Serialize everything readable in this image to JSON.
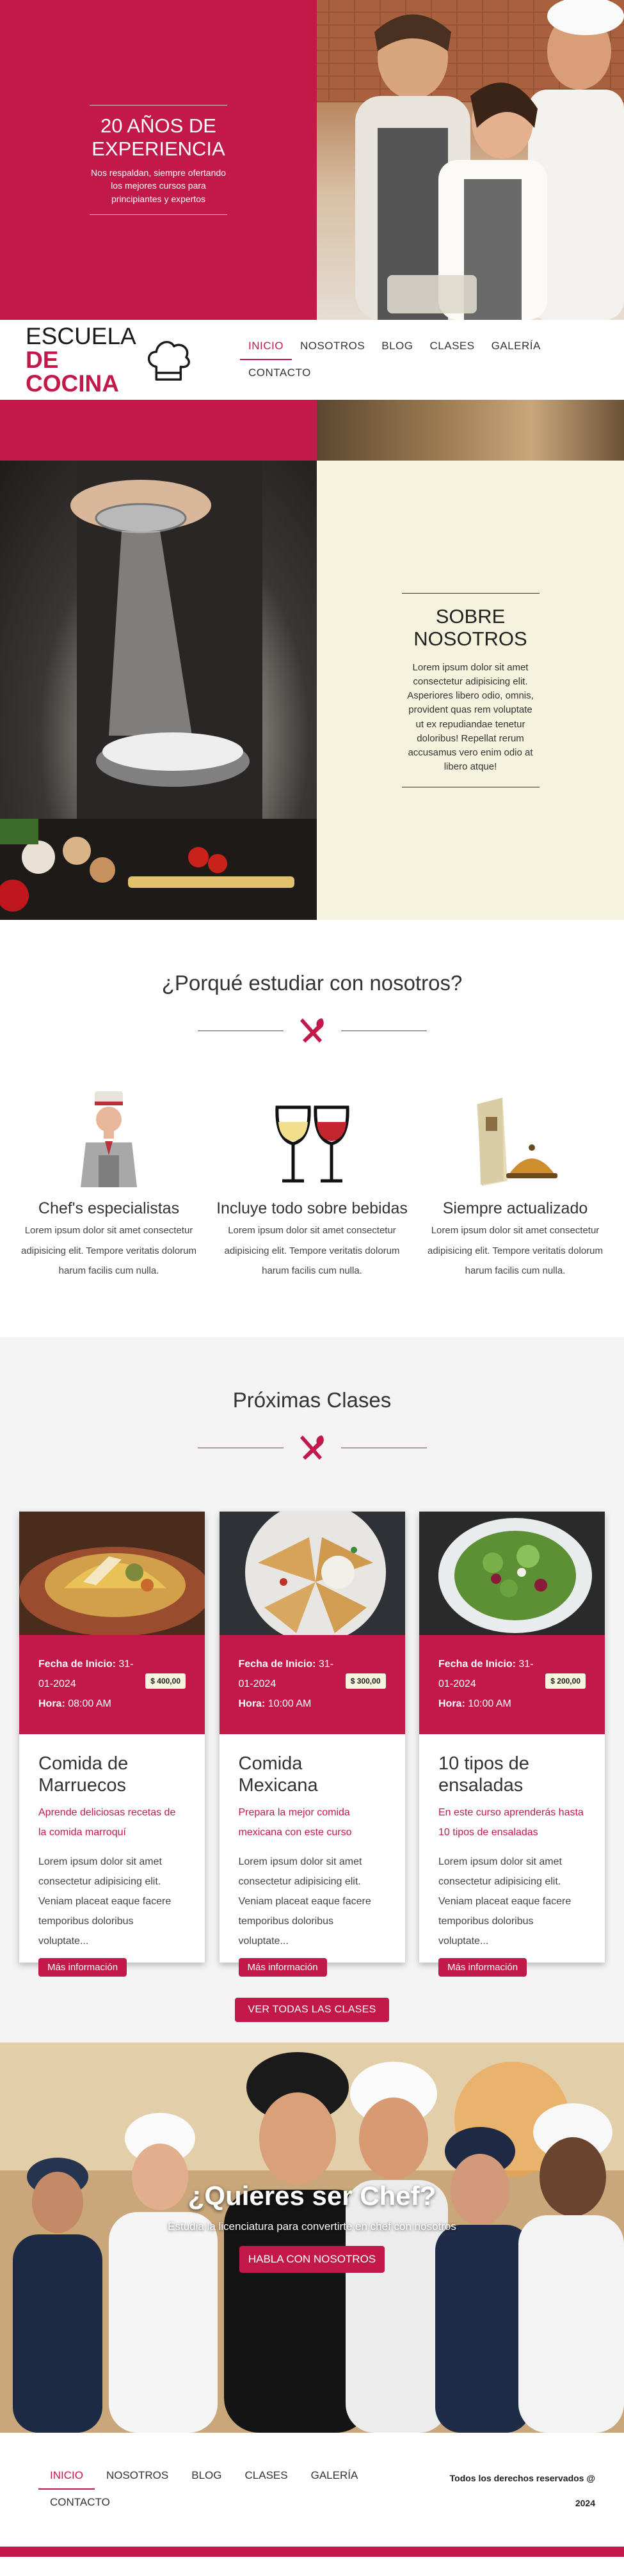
{
  "hero": {
    "title": "20 AÑOS DE EXPERIENCIA",
    "text": "Nos respaldan, siempre ofertando los mejores cursos para principiantes y expertos"
  },
  "logo": {
    "line1": "ESCUELA",
    "line2": "DE COCINA"
  },
  "nav": {
    "items": [
      {
        "label": "INICIO"
      },
      {
        "label": "NOSOTROS"
      },
      {
        "label": "BLOG"
      },
      {
        "label": "CLASES"
      },
      {
        "label": "GALERÍA"
      },
      {
        "label": "CONTACTO"
      }
    ]
  },
  "about": {
    "title": "SOBRE NOSOTROS",
    "text": "Lorem ipsum dolor sit amet consectetur adipisicing elit. Asperiores libero odio, omnis, provident quas rem voluptate ut ex repudiandae tenetur doloribus! Repellat rerum accusamus vero enim odio at libero atque!"
  },
  "why": {
    "title": "¿Porqué estudiar con nosotros?",
    "features": [
      {
        "title": "Chef's especialistas",
        "text": "Lorem ipsum dolor sit amet consectetur adipisicing elit. Tempore veritatis dolorum harum facilis cum nulla."
      },
      {
        "title": "Incluye todo sobre bebidas",
        "text": "Lorem ipsum dolor sit amet consectetur adipisicing elit. Tempore veritatis dolorum harum facilis cum nulla."
      },
      {
        "title": "Siempre actualizado",
        "text": "Lorem ipsum dolor sit amet consectetur adipisicing elit. Tempore veritatis dolorum harum facilis cum nulla."
      }
    ]
  },
  "classes": {
    "title": "Próximas Clases",
    "date_label": "Fecha de Inicio:",
    "time_label": "Hora:",
    "button_label": "Más información",
    "all_button": "VER TODAS LAS CLASES",
    "items": [
      {
        "date": "31-01-2024",
        "time": "08:00 AM",
        "price": "$ 400,00",
        "title": "Comida de Marruecos",
        "subtitle": "Aprende deliciosas recetas de la comida marroquí",
        "text": "Lorem ipsum dolor sit amet consectetur adipisicing elit. Veniam placeat eaque facere temporibus doloribus voluptate..."
      },
      {
        "date": "31-01-2024",
        "time": "10:00 AM",
        "price": "$ 300,00",
        "title": "Comida Mexicana",
        "subtitle": "Prepara la mejor comida mexicana con este curso",
        "text": "Lorem ipsum dolor sit amet consectetur adipisicing elit. Veniam placeat eaque facere temporibus doloribus voluptate..."
      },
      {
        "date": "31-01-2024",
        "time": "10:00 AM",
        "price": "$ 200,00",
        "title": "10 tipos de ensaladas",
        "subtitle": "En este curso aprenderás hasta 10 tipos de ensaladas",
        "text": "Lorem ipsum dolor sit amet consectetur adipisicing elit. Veniam placeat eaque facere temporibus doloribus voluptate..."
      }
    ]
  },
  "cta": {
    "title": "¿Quieres ser Chef?",
    "text": "Estudia la licenciatura para convertirte en chef con nosotros",
    "button": "HABLA CON NOSOTROS"
  },
  "footer": {
    "copyright": "Todos los derechos reservados @ 2024"
  },
  "colors": {
    "accent": "#c2194a",
    "cream": "#f5f3dd"
  }
}
